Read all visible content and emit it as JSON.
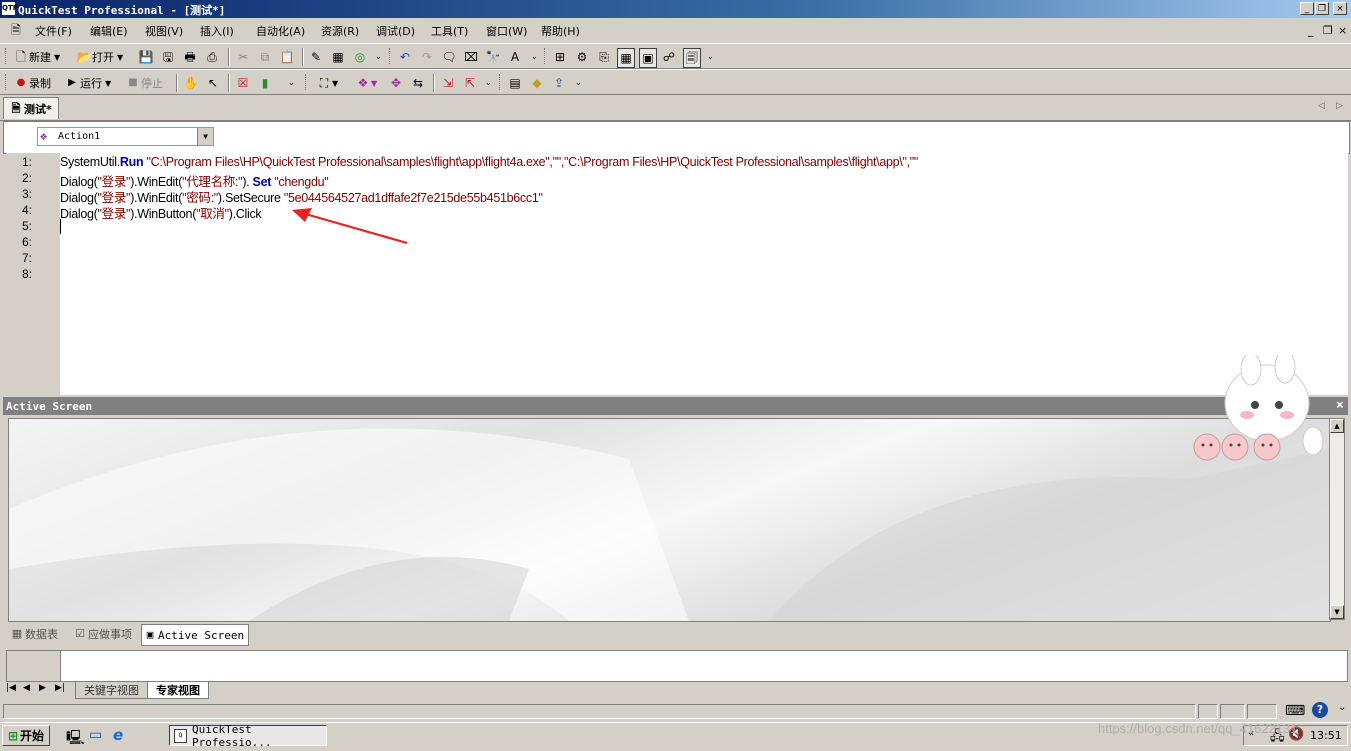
{
  "window": {
    "title": "QuickTest Professional - [测试*]",
    "app_icon": "QTP",
    "controls": {
      "minimize": "_",
      "restore": "❐",
      "close": "×"
    }
  },
  "menu": {
    "items": [
      "文件(F)",
      "编辑(E)",
      "视图(V)",
      "插入(I)",
      "自动化(A)",
      "资源(R)",
      "调试(D)",
      "工具(T)",
      "窗口(W)",
      "帮助(H)"
    ],
    "mdi": {
      "minimize": "_",
      "restore": "❐",
      "close": "×"
    }
  },
  "toolbar1": {
    "new": "新建",
    "open": "打开"
  },
  "toolbar2": {
    "record": "录制",
    "run": "运行",
    "stop": "停止"
  },
  "tab": {
    "label": "测试*"
  },
  "action_selector": {
    "value": "Action1",
    "dropdown_glyph": "▼"
  },
  "editor": {
    "line_numbers": [
      "1:",
      "2:",
      "3:",
      "4:",
      "5:",
      "6:",
      "7:",
      "8:"
    ],
    "lines": [
      [
        {
          "t": "SystemUtil.",
          "c": ""
        },
        {
          "t": "Run",
          "c": "k"
        },
        {
          "t": " \"C:\\Program Files\\HP\\QuickTest Professional\\samples\\flight\\app\\flight4a.exe\",\"\",\"C:\\Program Files\\HP\\QuickTest Professional\\samples\\flight\\app\\\",\"\"",
          "c": "s"
        }
      ],
      [
        {
          "t": "Dialog(",
          "c": ""
        },
        {
          "t": "\"登录\"",
          "c": "s"
        },
        {
          "t": ").WinEdit(",
          "c": ""
        },
        {
          "t": "\"代理名称:\"",
          "c": "s"
        },
        {
          "t": "). ",
          "c": ""
        },
        {
          "t": "Set",
          "c": "k"
        },
        {
          "t": " \"chengdu\"",
          "c": "s"
        }
      ],
      [
        {
          "t": "Dialog(",
          "c": ""
        },
        {
          "t": "\"登录\"",
          "c": "s"
        },
        {
          "t": ").WinEdit(",
          "c": ""
        },
        {
          "t": "\"密码:\"",
          "c": "s"
        },
        {
          "t": ").SetSecure ",
          "c": ""
        },
        {
          "t": "\"5e044564527ad1dffafe2f7e215de55b451b6cc1\"",
          "c": "s"
        }
      ],
      [
        {
          "t": "Dialog(",
          "c": ""
        },
        {
          "t": "\"登录\"",
          "c": "s"
        },
        {
          "t": ").WinButton(",
          "c": ""
        },
        {
          "t": "\"取消\"",
          "c": "s"
        },
        {
          "t": ").Click",
          "c": ""
        }
      ]
    ]
  },
  "active_screen": {
    "title": "Active Screen",
    "close": "×",
    "tabs": {
      "data_table": "数据表",
      "todo": "应做事项",
      "active_screen": "Active Screen"
    }
  },
  "view_tabs": {
    "keyword": "关键字视图",
    "expert": "专家视图"
  },
  "nav_glyphs": {
    "first": "|◀",
    "prev": "◀",
    "next": "▶",
    "last": "▶|"
  },
  "taskbar": {
    "start": "开始",
    "task_button": "QuickTest Professio...",
    "clock": "13:51"
  },
  "watermark": "https://blog.csdn.net/qq_41622131",
  "colors": {
    "string": "#800000",
    "keyword": "#0000aa",
    "arrow": "#e8221f",
    "title_start": "#0a246a"
  }
}
